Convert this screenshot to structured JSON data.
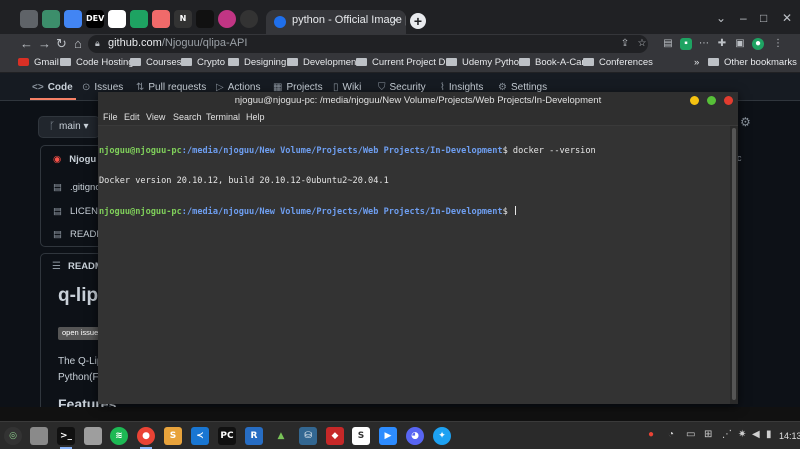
{
  "browser": {
    "active_tab_title": "python - Official Image | Dock",
    "mini_tabs": [
      "",
      "",
      "DEV",
      "",
      "",
      "",
      "N",
      "",
      "",
      ""
    ],
    "url_host": "github.com",
    "url_path": "/Njoguu/qlipa-API",
    "bookmarks": [
      "Gmail",
      "Code Hosting",
      "Courses",
      "Crypto",
      "Designing",
      "Development",
      "Current Project D...",
      "Udemy Python",
      "Book-A-Car",
      "Conferences"
    ],
    "other_bookmarks": "Other bookmarks"
  },
  "github": {
    "tabs": [
      "Code",
      "Issues",
      "Pull requests",
      "Actions",
      "Projects",
      "Wiki",
      "Security",
      "Insights",
      "Settings"
    ],
    "branch": "main",
    "owner_row": "Njogu",
    "files": [
      ".gitignore",
      "LICENSE",
      "README"
    ],
    "readme_header": "README",
    "repo_title": "q-lipa API",
    "badge": "open issue",
    "description_line1": "The Q-Lip",
    "description_line2": "Python(F",
    "features_heading": "Features"
  },
  "terminal": {
    "title": "njoguu@njoguu-pc: /media/njoguu/New Volume/Projects/Web Projects/In-Development",
    "menu": [
      "File",
      "Edit",
      "View",
      "Search",
      "Terminal",
      "Help"
    ],
    "prompt_user": "njoguu@njoguu-pc",
    "prompt_path": ":/media/njoguu/New Volume/Projects/Web Projects/In-Development",
    "command": "$ docker --version",
    "output": "Docker version 20.10.12, build 20.10.12-0ubuntu2~20.04.1",
    "prompt_end": "$ "
  },
  "panel": {
    "clock": "14:13"
  }
}
